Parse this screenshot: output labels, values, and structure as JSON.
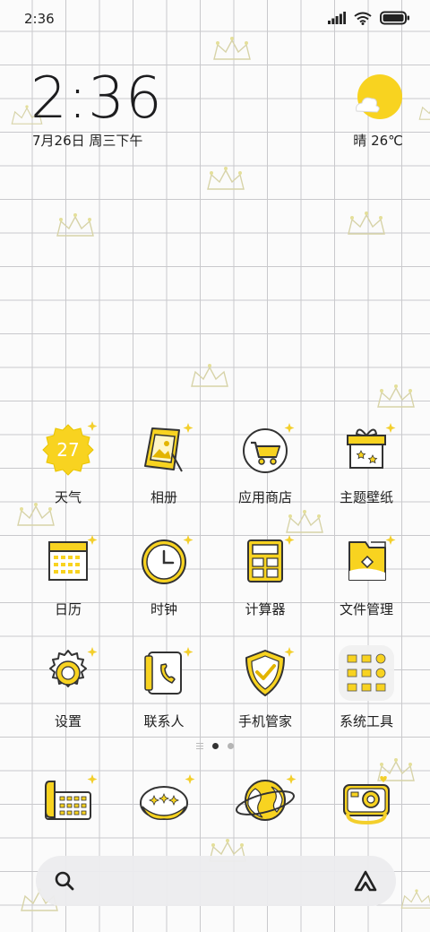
{
  "status_bar": {
    "time": "2:36",
    "icons": [
      "signal-icon",
      "wifi-icon",
      "battery-icon"
    ]
  },
  "clock_widget": {
    "time": "2:36",
    "date": "7月26日 周三下午"
  },
  "weather_widget": {
    "condition_icon": "sun-cloud-icon",
    "text": "晴 26℃"
  },
  "apps": [
    {
      "label": "天气",
      "icon": "weather-icon",
      "badge": "27"
    },
    {
      "label": "相册",
      "icon": "gallery-icon"
    },
    {
      "label": "应用商店",
      "icon": "app-store-icon"
    },
    {
      "label": "主题壁纸",
      "icon": "themes-icon"
    },
    {
      "label": "日历",
      "icon": "calendar-icon"
    },
    {
      "label": "时钟",
      "icon": "clock-icon"
    },
    {
      "label": "计算器",
      "icon": "calculator-icon"
    },
    {
      "label": "文件管理",
      "icon": "file-manager-icon"
    },
    {
      "label": "设置",
      "icon": "settings-icon"
    },
    {
      "label": "联系人",
      "icon": "contacts-icon"
    },
    {
      "label": "手机管家",
      "icon": "security-icon"
    },
    {
      "label": "系统工具",
      "icon": "system-tools-folder-icon"
    }
  ],
  "page_indicator": {
    "pages": 2,
    "current": 1
  },
  "dock": [
    {
      "icon": "phone-icon"
    },
    {
      "icon": "messages-icon"
    },
    {
      "icon": "browser-icon"
    },
    {
      "icon": "camera-icon"
    }
  ],
  "search_bar": {
    "left_icon": "search-icon",
    "right_icon": "assistant-icon"
  },
  "colors": {
    "accent_yellow": "#f5d21f",
    "outline": "#333333",
    "grid": "#c9c9cc"
  }
}
